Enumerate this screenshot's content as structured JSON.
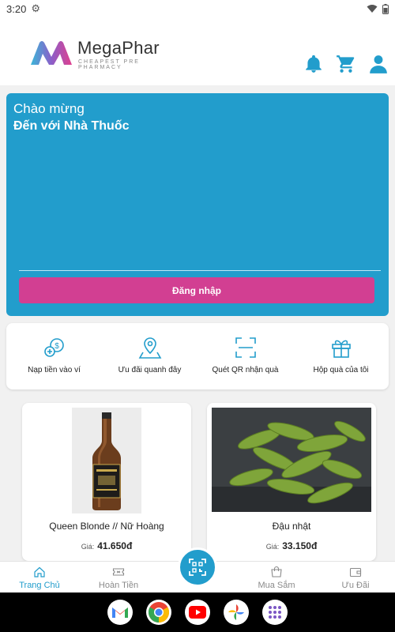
{
  "status_bar": {
    "time": "3:20"
  },
  "header": {
    "brand": "MegaPhar",
    "tagline": "CHEAPEST PRE PHARMACY"
  },
  "banner": {
    "greeting": "Chào mừng",
    "subtitle": "Đến với Nhà Thuốc",
    "login_label": "Đăng nhập"
  },
  "quick_actions": [
    {
      "label": "Nạp tiền vào ví",
      "icon": "wallet-topup-icon"
    },
    {
      "label": "Ưu đãi quanh đây",
      "icon": "location-pin-icon"
    },
    {
      "label": "Quét QR nhận quà",
      "icon": "qr-scan-icon"
    },
    {
      "label": "Hộp quà của tôi",
      "icon": "gift-box-icon"
    }
  ],
  "products": [
    {
      "name": "Queen Blonde // Nữ Hoàng",
      "price_label": "Giá:",
      "price": "41.650đ"
    },
    {
      "name": "Đậu nhật",
      "price_label": "Giá:",
      "price": "33.150đ"
    }
  ],
  "tabs": [
    {
      "label": "Trang Chủ",
      "icon": "home-icon",
      "active": true
    },
    {
      "label": "Hoàn Tiền",
      "icon": "ticket-icon",
      "active": false
    },
    {
      "label": "Mua Sắm",
      "icon": "shopping-bag-icon",
      "active": false
    },
    {
      "label": "Ưu Đãi",
      "icon": "wallet-icon",
      "active": false
    }
  ],
  "colors": {
    "primary": "#229dcc",
    "login_button": "#d23f92",
    "background": "#f1f1f1"
  },
  "dock_apps": [
    "gmail-icon",
    "chrome-icon",
    "youtube-icon",
    "photos-icon",
    "app-drawer-icon"
  ]
}
